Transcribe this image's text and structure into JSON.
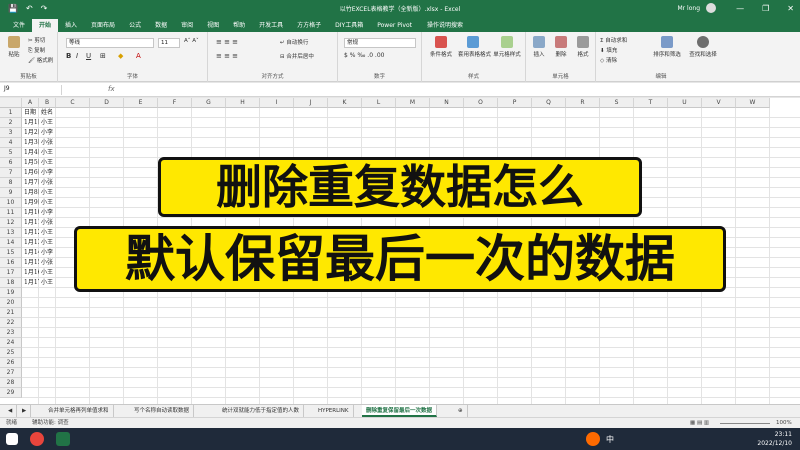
{
  "window": {
    "title": "以竹EXCEL表格教学（全新版）.xlsx - Excel",
    "user": "Mr long",
    "qat": [
      "💾",
      "↶",
      "↷"
    ],
    "controls": [
      "—",
      "❐",
      "✕"
    ]
  },
  "ribbon_tabs": [
    "文件",
    "开始",
    "插入",
    "页面布局",
    "公式",
    "数据",
    "审阅",
    "视图",
    "帮助",
    "开发工具",
    "方方格子",
    "DIY工具箱",
    "Power Pivot"
  ],
  "active_tab": "开始",
  "tell_me": "操作说明搜索",
  "ribbon": {
    "clipboard": {
      "paste": "粘贴",
      "cut": "剪切",
      "copy": "复制",
      "format_painter": "格式刷",
      "label": "剪贴板"
    },
    "font": {
      "name": "等线",
      "size": "11",
      "label": "字体",
      "bold": "B",
      "italic": "I",
      "underline": "U"
    },
    "alignment": {
      "wrap": "自动换行",
      "merge": "合并后居中",
      "label": "对齐方式"
    },
    "number": {
      "format": "常规",
      "label": "数字"
    },
    "styles": {
      "conditional": "条件格式",
      "table": "套用表格格式",
      "cell": "单元格样式",
      "label": "样式"
    },
    "cells": {
      "insert": "插入",
      "delete": "删除",
      "format": "格式",
      "label": "单元格"
    },
    "editing": {
      "autosum": "自动求和",
      "fill": "填充",
      "clear": "清除",
      "sort": "排序和筛选",
      "find": "查找和选择",
      "label": "编辑"
    }
  },
  "formula_bar": {
    "name_box": "J9",
    "fx": "fx",
    "content": ""
  },
  "columns": [
    "A",
    "B",
    "C",
    "D",
    "E",
    "F",
    "G",
    "H",
    "I",
    "J",
    "K",
    "L",
    "M",
    "N",
    "O",
    "P",
    "Q",
    "R",
    "S",
    "T",
    "U",
    "V",
    "W"
  ],
  "rows": [
    "1",
    "2",
    "3",
    "4",
    "5",
    "6",
    "7",
    "8",
    "9",
    "10",
    "11",
    "12",
    "13",
    "14",
    "15",
    "16",
    "17",
    "18",
    "19",
    "20",
    "21",
    "22",
    "23",
    "24",
    "25",
    "26",
    "27",
    "28",
    "29"
  ],
  "cells": [
    [
      "日期",
      "姓名"
    ],
    [
      "1月1日",
      "小王"
    ],
    [
      "1月2日",
      "小李"
    ],
    [
      "1月3日",
      "小张"
    ],
    [
      "1月4日",
      "小王"
    ],
    [
      "1月5日",
      "小王"
    ],
    [
      "1月6日",
      "小李"
    ],
    [
      "1月7日",
      "小张"
    ],
    [
      "1月8日",
      "小王"
    ],
    [
      "1月9日",
      "小王"
    ],
    [
      "1月10日",
      "小李"
    ],
    [
      "1月11日",
      "小张"
    ],
    [
      "1月12日",
      "小王"
    ],
    [
      "1月13日",
      "小王"
    ],
    [
      "1月14日",
      "小李"
    ],
    [
      "1月15日",
      "小张"
    ],
    [
      "1月16日",
      "小王"
    ],
    [
      "1月17日",
      "小王"
    ]
  ],
  "overlay": {
    "line1": "删除重复数据怎么",
    "line2": "默认保留最后一次的数据"
  },
  "sheet_tabs": [
    "合并单元格再列单值求和",
    "写个名称自动读取数据",
    "统计双就能力低于指定值的人数",
    "HYPERLINK",
    "删除重复保留最后一次数据"
  ],
  "active_sheet": "删除重复保留最后一次数据",
  "status": {
    "ready": "就绪",
    "accessibility": "辅助功能: 调查",
    "zoom": "100%"
  },
  "clock": {
    "time": "23:11",
    "date": "2022/12/10"
  },
  "ime": "中",
  "colors": {
    "excel_green": "#217346",
    "overlay_yellow": "#ffe800"
  }
}
